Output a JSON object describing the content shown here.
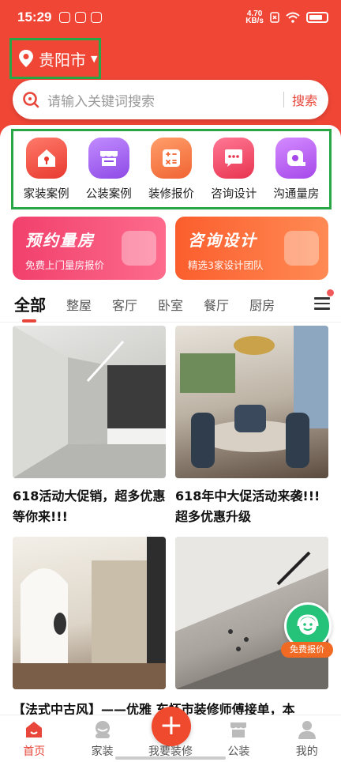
{
  "status_bar": {
    "time": "15:29",
    "net_speed_value": "4.70",
    "net_speed_unit": "KB/s"
  },
  "location": {
    "city": "贵阳市",
    "caret": "▼"
  },
  "search": {
    "placeholder": "请输入关键词搜索",
    "button": "搜索"
  },
  "categories": [
    {
      "label": "家装案例",
      "icon": "house-icon",
      "color": "#f04c44"
    },
    {
      "label": "公装案例",
      "icon": "shop-icon",
      "color": "#9b5cf0"
    },
    {
      "label": "装修报价",
      "icon": "calculator-icon",
      "color": "#f5733a"
    },
    {
      "label": "咨询设计",
      "icon": "chat-icon",
      "color": "#f2415f"
    },
    {
      "label": "沟通量房",
      "icon": "tape-measure-icon",
      "color": "#b957f1"
    }
  ],
  "banners": [
    {
      "title": "预约量房",
      "subtitle": "免费上门量房报价"
    },
    {
      "title": "咨询设计",
      "subtitle": "精选3家设计团队"
    }
  ],
  "tabs": [
    "全部",
    "整屋",
    "客厅",
    "卧室",
    "餐厅",
    "厨房"
  ],
  "feed": [
    {
      "title": "618活动大促销，超多优惠等你来!!!"
    },
    {
      "title": "618年中大促活动来袭!!! 超多优惠升级"
    },
    {
      "title": ""
    },
    {
      "title": ""
    }
  ],
  "bottom_line": "【法式中古风】——优雅   东怀市装修师傅接单，本",
  "float_button": {
    "label": "免费报价"
  },
  "tabbar": {
    "items": [
      "首页",
      "家装",
      "我要装修",
      "公装",
      "我的"
    ],
    "center_symbol": "+"
  },
  "colors": {
    "brand": "#ef4636",
    "highlight_box": "#27a745"
  }
}
